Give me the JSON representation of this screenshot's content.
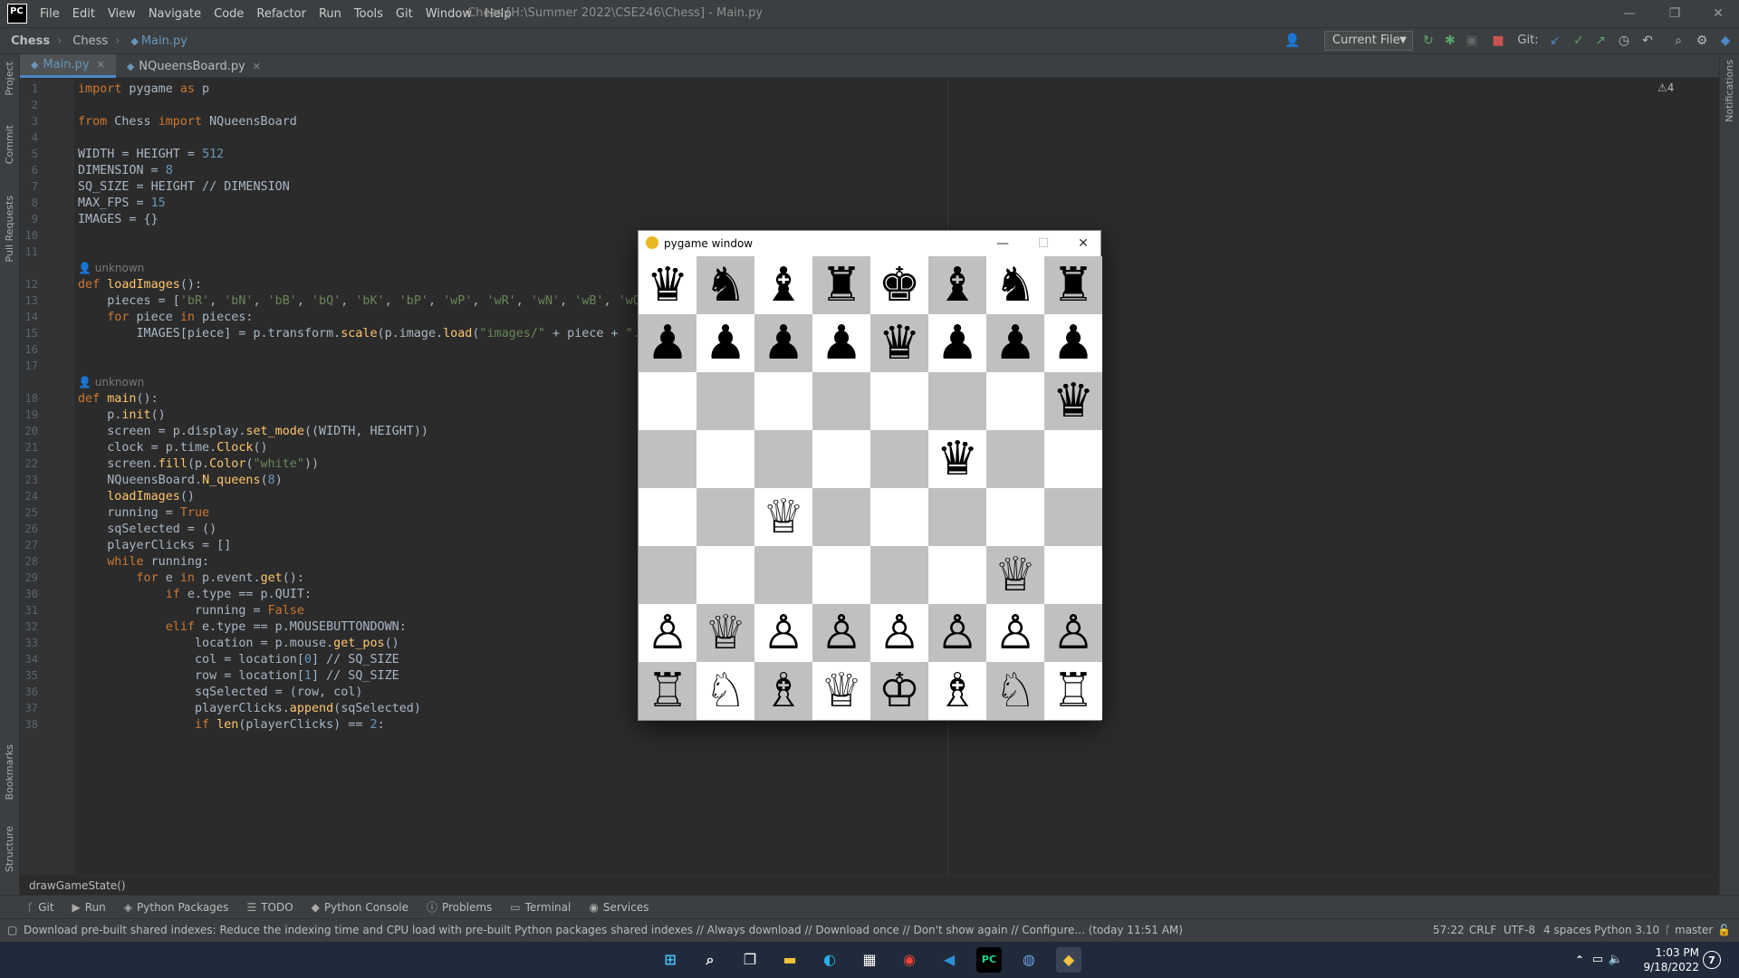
{
  "titlebar": {
    "logo": "PC",
    "menu": [
      "File",
      "Edit",
      "View",
      "Navigate",
      "Code",
      "Refactor",
      "Run",
      "Tools",
      "Git",
      "Window",
      "Help"
    ],
    "window_title": "Chess [H:\\Summer 2022\\CSE246\\Chess] - Main.py"
  },
  "navbar": {
    "crumbs": [
      "Chess",
      "Chess",
      "Main.py"
    ],
    "run_config": "Current File",
    "git_label": "Git:"
  },
  "side_labels": {
    "left_top": [
      "Project",
      "Commit",
      "Pull Requests"
    ],
    "left_bottom": [
      "Bookmarks",
      "Structure"
    ],
    "right": [
      "Notifications"
    ]
  },
  "tabs": [
    {
      "label": "Main.py",
      "active": true
    },
    {
      "label": "NQueensBoard.py",
      "active": false
    }
  ],
  "editor": {
    "warning_badge": "⚠4",
    "lines": [
      {
        "n": "1",
        "text": "import pygame as p"
      },
      {
        "n": "2",
        "text": ""
      },
      {
        "n": "3",
        "text": "from Chess import NQueensBoard"
      },
      {
        "n": "4",
        "text": ""
      },
      {
        "n": "5",
        "text": "WIDTH = HEIGHT = 512"
      },
      {
        "n": "6",
        "text": "DIMENSION = 8"
      },
      {
        "n": "7",
        "text": "SQ_SIZE = HEIGHT // DIMENSION"
      },
      {
        "n": "8",
        "text": "MAX_FPS = 15"
      },
      {
        "n": "9",
        "text": "IMAGES = {}"
      },
      {
        "n": "10",
        "text": ""
      },
      {
        "n": "11",
        "text": ""
      },
      {
        "n": "",
        "text": "unknown",
        "hint": true
      },
      {
        "n": "12",
        "text": "def loadImages():"
      },
      {
        "n": "13",
        "text": "    pieces = ['bR', 'bN', 'bB', 'bQ', 'bK', 'bP', 'wP', 'wR', 'wN', 'wB', 'wQ"
      },
      {
        "n": "14",
        "text": "    for piece in pieces:"
      },
      {
        "n": "15",
        "text": "        IMAGES[piece] = p.transform.scale(p.image.load(\"images/\" + piece + \"."
      },
      {
        "n": "16",
        "text": ""
      },
      {
        "n": "17",
        "text": ""
      },
      {
        "n": "",
        "text": "unknown",
        "hint": true
      },
      {
        "n": "18",
        "text": "def main():"
      },
      {
        "n": "19",
        "text": "    p.init()"
      },
      {
        "n": "20",
        "text": "    screen = p.display.set_mode((WIDTH, HEIGHT))"
      },
      {
        "n": "21",
        "text": "    clock = p.time.Clock()"
      },
      {
        "n": "22",
        "text": "    screen.fill(p.Color(\"white\"))"
      },
      {
        "n": "23",
        "text": "    NQueensBoard.N_queens(8)"
      },
      {
        "n": "24",
        "text": "    loadImages()"
      },
      {
        "n": "25",
        "text": "    running = True"
      },
      {
        "n": "26",
        "text": "    sqSelected = ()"
      },
      {
        "n": "27",
        "text": "    playerClicks = []"
      },
      {
        "n": "28",
        "text": "    while running:"
      },
      {
        "n": "29",
        "text": "        for e in p.event.get():"
      },
      {
        "n": "30",
        "text": "            if e.type == p.QUIT:"
      },
      {
        "n": "31",
        "text": "                running = False"
      },
      {
        "n": "32",
        "text": "            elif e.type == p.MOUSEBUTTONDOWN:"
      },
      {
        "n": "33",
        "text": "                location = p.mouse.get_pos()"
      },
      {
        "n": "34",
        "text": "                col = location[0] // SQ_SIZE"
      },
      {
        "n": "35",
        "text": "                row = location[1] // SQ_SIZE"
      },
      {
        "n": "36",
        "text": "                sqSelected = (row, col)"
      },
      {
        "n": "37",
        "text": "                playerClicks.append(sqSelected)"
      },
      {
        "n": "38",
        "text": "                if len(playerClicks) == 2:"
      }
    ],
    "bottom_breadcrumb": "drawGameState()"
  },
  "tool_tabs": [
    "Git",
    "Run",
    "Python Packages",
    "TODO",
    "Python Console",
    "Problems",
    "Terminal",
    "Services"
  ],
  "status": {
    "message": "Download pre-built shared indexes: Reduce the indexing time and CPU load with pre-built Python packages shared indexes // Always download // Download once // Don't show again // Configure... (today 11:51 AM)",
    "position": "57:22",
    "line_sep": "CRLF",
    "encoding": "UTF-8",
    "indent": "4 spaces",
    "interpreter": "Python 3.10",
    "branch": "master"
  },
  "pygame": {
    "title": "pygame window",
    "board": [
      [
        "♛",
        "♞",
        "♝",
        "♜",
        "♚",
        "♝",
        "♞",
        "♜"
      ],
      [
        "♟",
        "♟",
        "♟",
        "♟",
        "♛",
        "♟",
        "♟",
        "♟"
      ],
      [
        "",
        "",
        "",
        "",
        "",
        "",
        "",
        "♛"
      ],
      [
        "",
        "",
        "",
        "",
        "",
        "♛",
        "",
        ""
      ],
      [
        "",
        "",
        "♕",
        "",
        "",
        "",
        "",
        ""
      ],
      [
        "",
        "",
        "",
        "",
        "",
        "",
        "♕",
        ""
      ],
      [
        "♙",
        "♕",
        "♙",
        "♙",
        "♙",
        "♙",
        "♙",
        "♙"
      ],
      [
        "♖",
        "♘",
        "♗",
        "♕",
        "♔",
        "♗",
        "♘",
        "♖"
      ]
    ]
  },
  "taskbar": {
    "time": "1:03 PM",
    "date": "9/18/2022",
    "notif_count": "7"
  },
  "colors": {
    "keyword": "#cc7832",
    "number": "#6897bb",
    "string": "#6a8759",
    "call": "#ffc66d",
    "self_dim": "#94558d",
    "board_dark": "#c0c0c0",
    "board_light": "#ffffff"
  }
}
